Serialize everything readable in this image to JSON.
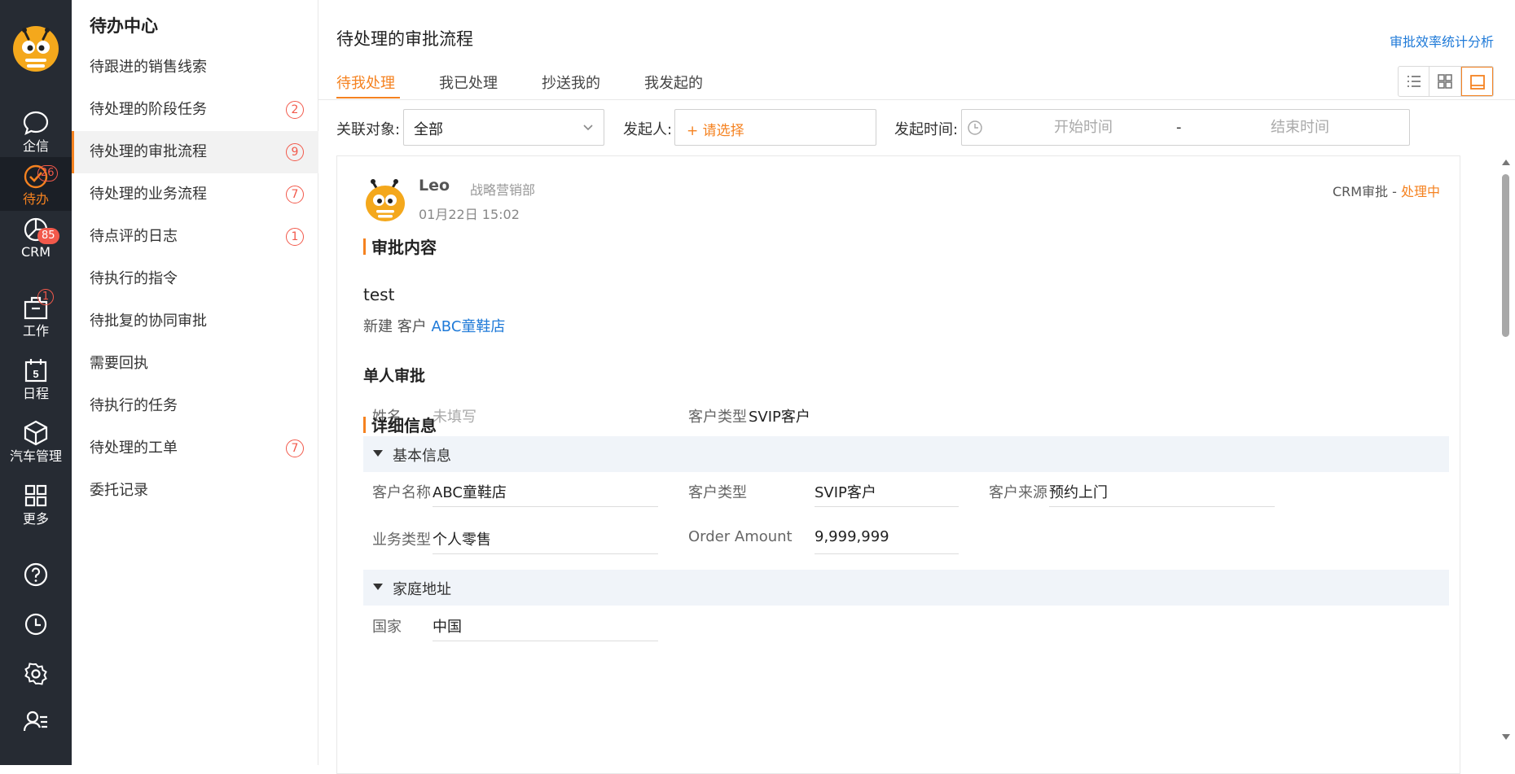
{
  "rail": {
    "items": [
      {
        "label": "企信",
        "icon": "chat-bubble-icon"
      },
      {
        "label": "待办",
        "icon": "check-circle-icon",
        "badge": "26"
      },
      {
        "label": "CRM",
        "icon": "pie-chart-icon",
        "badge": "85"
      },
      {
        "label": "工作",
        "icon": "briefcase-icon",
        "badge": "1"
      },
      {
        "label": "日程",
        "icon": "calendar-icon",
        "day": "5"
      },
      {
        "label": "汽车管理",
        "icon": "cube-icon"
      },
      {
        "label": "更多",
        "icon": "grid-icon"
      }
    ],
    "bottom_icons": [
      "help-icon",
      "history-clock-icon",
      "settings-gear-icon",
      "user-list-icon"
    ],
    "active_index": 1
  },
  "panel": {
    "title": "待办中心",
    "items": [
      {
        "label": "待跟进的销售线索"
      },
      {
        "label": "待处理的阶段任务",
        "badge": "2"
      },
      {
        "label": "待处理的审批流程",
        "badge": "9",
        "active": true
      },
      {
        "label": "待处理的业务流程",
        "badge": "7"
      },
      {
        "label": "待点评的日志",
        "badge": "1"
      },
      {
        "label": "待执行的指令"
      },
      {
        "label": "待批复的协同审批"
      },
      {
        "label": "需要回执"
      },
      {
        "label": "待执行的任务"
      },
      {
        "label": "待处理的工单",
        "badge": "7"
      },
      {
        "label": "委托记录"
      }
    ]
  },
  "main": {
    "title": "待处理的审批流程",
    "stat_link": "审批效率统计分析",
    "tabs": [
      {
        "label": "待我处理",
        "active": true
      },
      {
        "label": "我已处理"
      },
      {
        "label": "抄送我的"
      },
      {
        "label": "我发起的"
      }
    ],
    "view_modes": [
      "list-view-icon",
      "grid-view-icon",
      "card-view-icon"
    ],
    "view_selected": "card-view-icon"
  },
  "filters": {
    "related_label": "关联对象:",
    "related_value": "全部",
    "initiator_label": "发起人:",
    "initiator_placeholder": "+ 请选择",
    "time_label": "发起时间:",
    "start_placeholder": "开始时间",
    "dash": "-",
    "end_placeholder": "结束时间"
  },
  "card": {
    "user_name": "Leo",
    "department": "战略营销部",
    "time": "01月22日 15:02",
    "status_prefix": "CRM审批 - ",
    "status": "处理中",
    "content_title": "审批内容",
    "content_text": "test",
    "content_action": "新建 客户",
    "content_link": "ABC童鞋店",
    "single_approval_title": "单人审批",
    "single_fields": {
      "name_label": "姓名",
      "name_value": "未填写",
      "type_label": "客户类型",
      "type_value": "SVIP客户"
    },
    "detail_title": "详细信息",
    "groups": [
      {
        "title": "基本信息",
        "fields": {
          "customer_name_label": "客户名称",
          "customer_name": "ABC童鞋店",
          "customer_type_label": "客户类型",
          "customer_type": "SVIP客户",
          "source_label": "客户来源",
          "source": "预约上门",
          "biz_type_label": "业务类型",
          "biz_type": "个人零售",
          "amount_label": "Order Amount",
          "amount": "9,999,999"
        }
      },
      {
        "title": "家庭地址",
        "fields": {
          "country_label": "国家",
          "country": "中国"
        }
      }
    ]
  },
  "colors": {
    "accent": "#f58220",
    "link": "#1f7ad8",
    "badge": "#f2594b",
    "rail_bg": "#262b33"
  }
}
